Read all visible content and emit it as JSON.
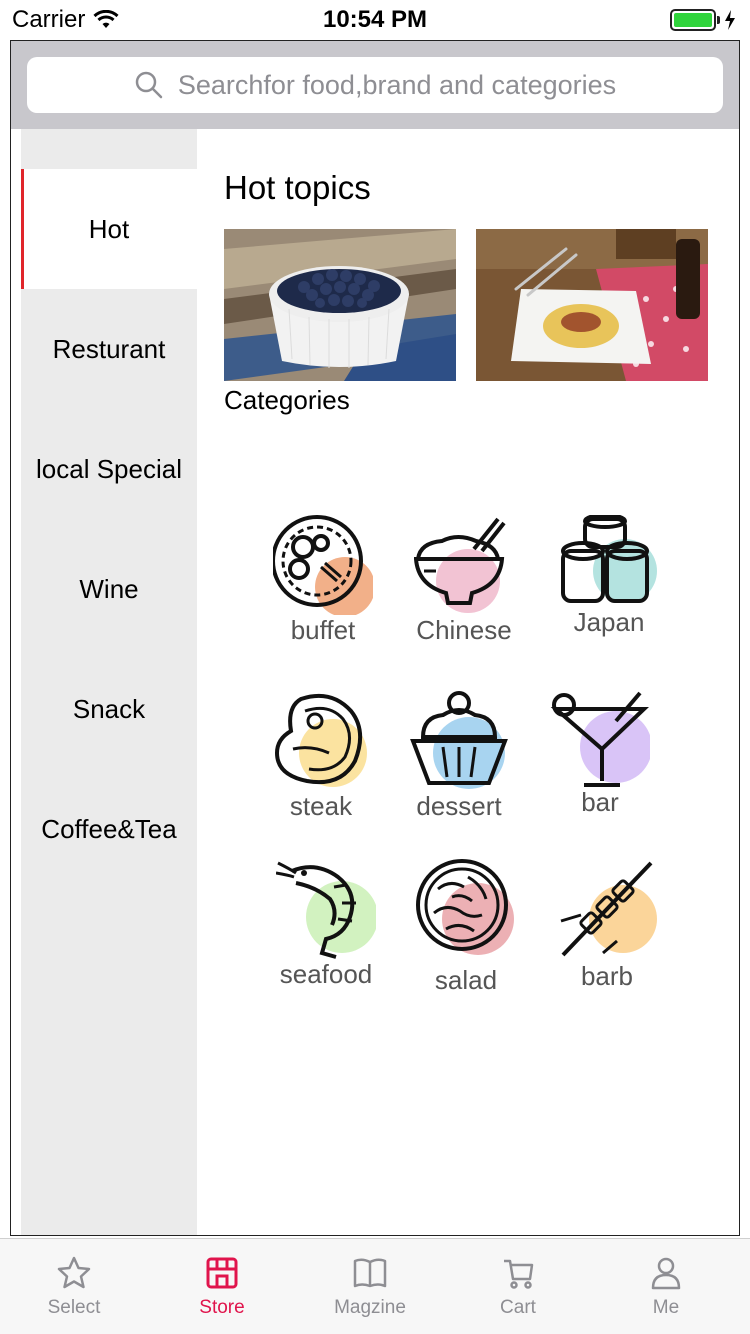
{
  "status_bar": {
    "carrier": "Carrier",
    "time": "10:54 PM"
  },
  "search": {
    "placeholder": "Searchfor food,brand and categories"
  },
  "sidebar": {
    "items": [
      {
        "label": "Hot",
        "active": true
      },
      {
        "label": "Resturant"
      },
      {
        "label": "local Special"
      },
      {
        "label": "Wine"
      },
      {
        "label": "Snack"
      },
      {
        "label": "Coffee&Tea"
      }
    ]
  },
  "main": {
    "hot_title": "Hot topics",
    "categories_title": "Categories",
    "categories": [
      {
        "label": "buffet",
        "icon": "buffet-icon",
        "color": "#f2b089"
      },
      {
        "label": "Chinese",
        "icon": "rice-bowl-icon",
        "color": "#f2c3d3"
      },
      {
        "label": "Japan",
        "icon": "sushi-icon",
        "color": "#b4e3e0"
      },
      {
        "label": "steak",
        "icon": "steak-icon",
        "color": "#fbe3a0"
      },
      {
        "label": "dessert",
        "icon": "ice-cream-icon",
        "color": "#a8d4f0"
      },
      {
        "label": "bar",
        "icon": "cocktail-icon",
        "color": "#d9c4f7"
      },
      {
        "label": "seafood",
        "icon": "shrimp-icon",
        "color": "#d2f2c0"
      },
      {
        "label": "salad",
        "icon": "salad-icon",
        "color": "#ecb0b4"
      },
      {
        "label": "barb",
        "icon": "skewer-icon",
        "color": "#fbd59a"
      }
    ]
  },
  "tab_bar": {
    "tabs": [
      {
        "label": "Select",
        "icon": "star-icon"
      },
      {
        "label": "Store",
        "icon": "store-icon",
        "active": true
      },
      {
        "label": "Magzine",
        "icon": "book-icon"
      },
      {
        "label": "Cart",
        "icon": "cart-icon"
      },
      {
        "label": "Me",
        "icon": "person-icon"
      }
    ]
  },
  "colors": {
    "accent": "#e0144c",
    "sidebar_bg": "#ebebeb",
    "search_bg": "#c8c7cc",
    "active_indicator": "#e0252a"
  }
}
